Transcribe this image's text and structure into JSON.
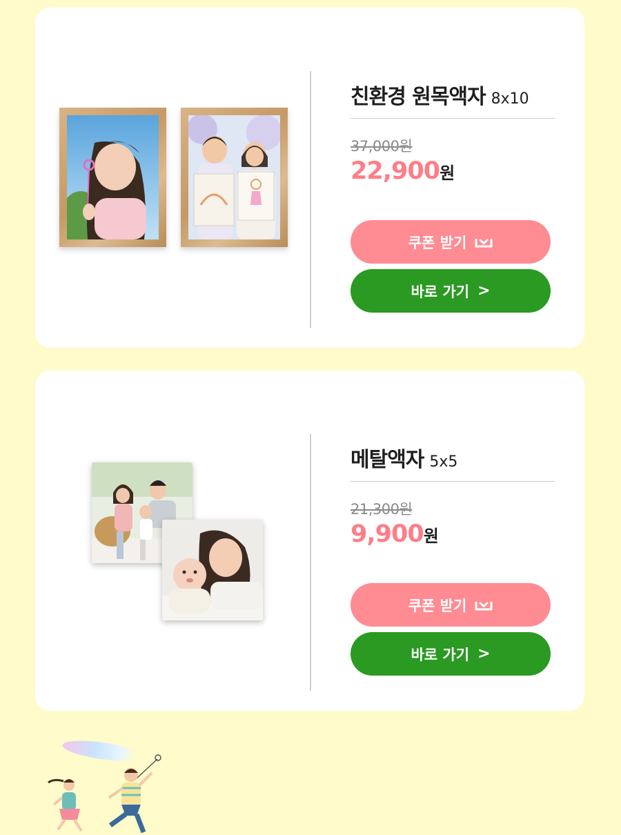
{
  "products": [
    {
      "title": "친환경 원목액자",
      "size": "8x10",
      "original_price": "37,000원",
      "sale_price": "22,900",
      "currency": "원",
      "coupon_label": "쿠폰 받기",
      "go_label": "바로 가기",
      "go_icon": ">"
    },
    {
      "title": "메탈액자",
      "size": "5x5",
      "original_price": "21,300원",
      "sale_price": "9,900",
      "currency": "원",
      "coupon_label": "쿠폰 받기",
      "go_label": "바로 가기",
      "go_icon": ">"
    }
  ],
  "colors": {
    "background": "#fffbcb",
    "card": "#ffffff",
    "sale_price": "#ff7d87",
    "coupon_button": "#ff8b93",
    "go_button": "#2a9a22"
  },
  "icons": [
    "download-icon",
    "chevron-right-icon"
  ]
}
